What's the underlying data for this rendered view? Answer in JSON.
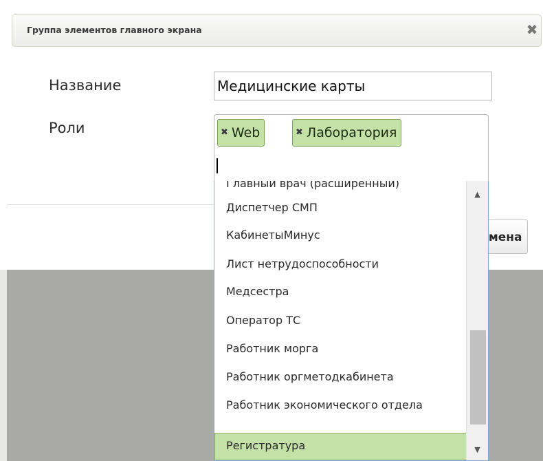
{
  "dialog": {
    "title": "Группа элементов главного экрана",
    "close_icon": "close-icon"
  },
  "form": {
    "name_label": "Название",
    "name_value": "Медицинские карты",
    "roles_label": "Роли"
  },
  "roles": {
    "selected": [
      {
        "label": "Web"
      },
      {
        "label": "Лаборатория"
      }
    ],
    "remove_icon": "remove-tag-icon"
  },
  "dropdown": {
    "items": [
      "Главный врач (расширенный)",
      "Диспетчер СМП",
      "КабинетыМинус",
      "Лист нетрудоспособности",
      "Медсестра",
      "Оператор ТС",
      "Работник морга",
      "Работник оргметодкабинета",
      "Работник экономического отдела",
      "Регистратура"
    ],
    "highlighted_item": "Регистратура",
    "scroll_up_icon": "triangle-up-icon",
    "scroll_down_icon": "triangle-down-icon"
  },
  "footer": {
    "close_button_label": "Отмена"
  },
  "colors": {
    "tag_background": "#c4e2a8",
    "tag_border": "#7ba358",
    "dropdown_border": "#7fa7d8",
    "overlay": "#a9a9a6"
  }
}
